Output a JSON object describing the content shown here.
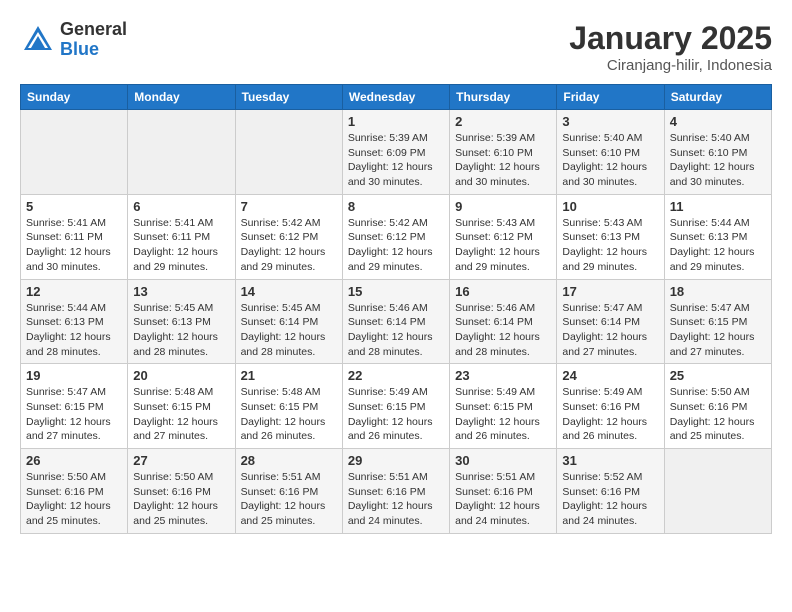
{
  "header": {
    "logo_line1": "General",
    "logo_line2": "Blue",
    "title": "January 2025",
    "subtitle": "Ciranjang-hilir, Indonesia"
  },
  "weekdays": [
    "Sunday",
    "Monday",
    "Tuesday",
    "Wednesday",
    "Thursday",
    "Friday",
    "Saturday"
  ],
  "weeks": [
    [
      {
        "day": "",
        "detail": ""
      },
      {
        "day": "",
        "detail": ""
      },
      {
        "day": "",
        "detail": ""
      },
      {
        "day": "1",
        "detail": "Sunrise: 5:39 AM\nSunset: 6:09 PM\nDaylight: 12 hours\nand 30 minutes."
      },
      {
        "day": "2",
        "detail": "Sunrise: 5:39 AM\nSunset: 6:10 PM\nDaylight: 12 hours\nand 30 minutes."
      },
      {
        "day": "3",
        "detail": "Sunrise: 5:40 AM\nSunset: 6:10 PM\nDaylight: 12 hours\nand 30 minutes."
      },
      {
        "day": "4",
        "detail": "Sunrise: 5:40 AM\nSunset: 6:10 PM\nDaylight: 12 hours\nand 30 minutes."
      }
    ],
    [
      {
        "day": "5",
        "detail": "Sunrise: 5:41 AM\nSunset: 6:11 PM\nDaylight: 12 hours\nand 30 minutes."
      },
      {
        "day": "6",
        "detail": "Sunrise: 5:41 AM\nSunset: 6:11 PM\nDaylight: 12 hours\nand 29 minutes."
      },
      {
        "day": "7",
        "detail": "Sunrise: 5:42 AM\nSunset: 6:12 PM\nDaylight: 12 hours\nand 29 minutes."
      },
      {
        "day": "8",
        "detail": "Sunrise: 5:42 AM\nSunset: 6:12 PM\nDaylight: 12 hours\nand 29 minutes."
      },
      {
        "day": "9",
        "detail": "Sunrise: 5:43 AM\nSunset: 6:12 PM\nDaylight: 12 hours\nand 29 minutes."
      },
      {
        "day": "10",
        "detail": "Sunrise: 5:43 AM\nSunset: 6:13 PM\nDaylight: 12 hours\nand 29 minutes."
      },
      {
        "day": "11",
        "detail": "Sunrise: 5:44 AM\nSunset: 6:13 PM\nDaylight: 12 hours\nand 29 minutes."
      }
    ],
    [
      {
        "day": "12",
        "detail": "Sunrise: 5:44 AM\nSunset: 6:13 PM\nDaylight: 12 hours\nand 28 minutes."
      },
      {
        "day": "13",
        "detail": "Sunrise: 5:45 AM\nSunset: 6:13 PM\nDaylight: 12 hours\nand 28 minutes."
      },
      {
        "day": "14",
        "detail": "Sunrise: 5:45 AM\nSunset: 6:14 PM\nDaylight: 12 hours\nand 28 minutes."
      },
      {
        "day": "15",
        "detail": "Sunrise: 5:46 AM\nSunset: 6:14 PM\nDaylight: 12 hours\nand 28 minutes."
      },
      {
        "day": "16",
        "detail": "Sunrise: 5:46 AM\nSunset: 6:14 PM\nDaylight: 12 hours\nand 28 minutes."
      },
      {
        "day": "17",
        "detail": "Sunrise: 5:47 AM\nSunset: 6:14 PM\nDaylight: 12 hours\nand 27 minutes."
      },
      {
        "day": "18",
        "detail": "Sunrise: 5:47 AM\nSunset: 6:15 PM\nDaylight: 12 hours\nand 27 minutes."
      }
    ],
    [
      {
        "day": "19",
        "detail": "Sunrise: 5:47 AM\nSunset: 6:15 PM\nDaylight: 12 hours\nand 27 minutes."
      },
      {
        "day": "20",
        "detail": "Sunrise: 5:48 AM\nSunset: 6:15 PM\nDaylight: 12 hours\nand 27 minutes."
      },
      {
        "day": "21",
        "detail": "Sunrise: 5:48 AM\nSunset: 6:15 PM\nDaylight: 12 hours\nand 26 minutes."
      },
      {
        "day": "22",
        "detail": "Sunrise: 5:49 AM\nSunset: 6:15 PM\nDaylight: 12 hours\nand 26 minutes."
      },
      {
        "day": "23",
        "detail": "Sunrise: 5:49 AM\nSunset: 6:15 PM\nDaylight: 12 hours\nand 26 minutes."
      },
      {
        "day": "24",
        "detail": "Sunrise: 5:49 AM\nSunset: 6:16 PM\nDaylight: 12 hours\nand 26 minutes."
      },
      {
        "day": "25",
        "detail": "Sunrise: 5:50 AM\nSunset: 6:16 PM\nDaylight: 12 hours\nand 25 minutes."
      }
    ],
    [
      {
        "day": "26",
        "detail": "Sunrise: 5:50 AM\nSunset: 6:16 PM\nDaylight: 12 hours\nand 25 minutes."
      },
      {
        "day": "27",
        "detail": "Sunrise: 5:50 AM\nSunset: 6:16 PM\nDaylight: 12 hours\nand 25 minutes."
      },
      {
        "day": "28",
        "detail": "Sunrise: 5:51 AM\nSunset: 6:16 PM\nDaylight: 12 hours\nand 25 minutes."
      },
      {
        "day": "29",
        "detail": "Sunrise: 5:51 AM\nSunset: 6:16 PM\nDaylight: 12 hours\nand 24 minutes."
      },
      {
        "day": "30",
        "detail": "Sunrise: 5:51 AM\nSunset: 6:16 PM\nDaylight: 12 hours\nand 24 minutes."
      },
      {
        "day": "31",
        "detail": "Sunrise: 5:52 AM\nSunset: 6:16 PM\nDaylight: 12 hours\nand 24 minutes."
      },
      {
        "day": "",
        "detail": ""
      }
    ]
  ]
}
